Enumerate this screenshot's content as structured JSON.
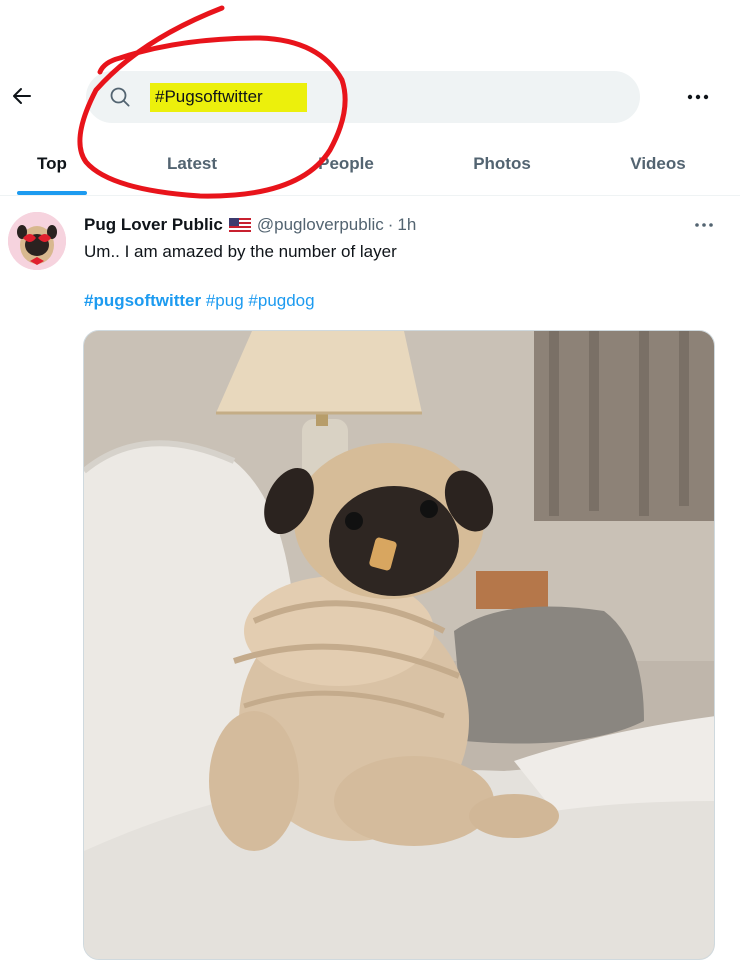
{
  "search": {
    "query": "#Pugsoftwitter"
  },
  "tabs": [
    {
      "label": "Top",
      "active": true
    },
    {
      "label": "Latest",
      "active": false
    },
    {
      "label": "People",
      "active": false
    },
    {
      "label": "Photos",
      "active": false
    },
    {
      "label": "Videos",
      "active": false
    }
  ],
  "tweet": {
    "display_name": "Pug Lover Public",
    "handle": "@pugloverpublic",
    "separator": "·",
    "time": "1h",
    "text": "Um.. I am amazed by the number of layer",
    "hashtags": [
      "#pugsoftwitter",
      "#pug",
      "#pugdog"
    ]
  },
  "icons": {
    "back": "arrow-left-icon",
    "search": "search-icon",
    "more": "more-horizontal-icon",
    "flag": "us-flag-icon"
  },
  "colors": {
    "accent": "#1d9bf0",
    "highlight": "#ecf00c",
    "annotation": "#e8141b",
    "search_bg": "#eff3f4",
    "secondary_text": "#536471"
  }
}
